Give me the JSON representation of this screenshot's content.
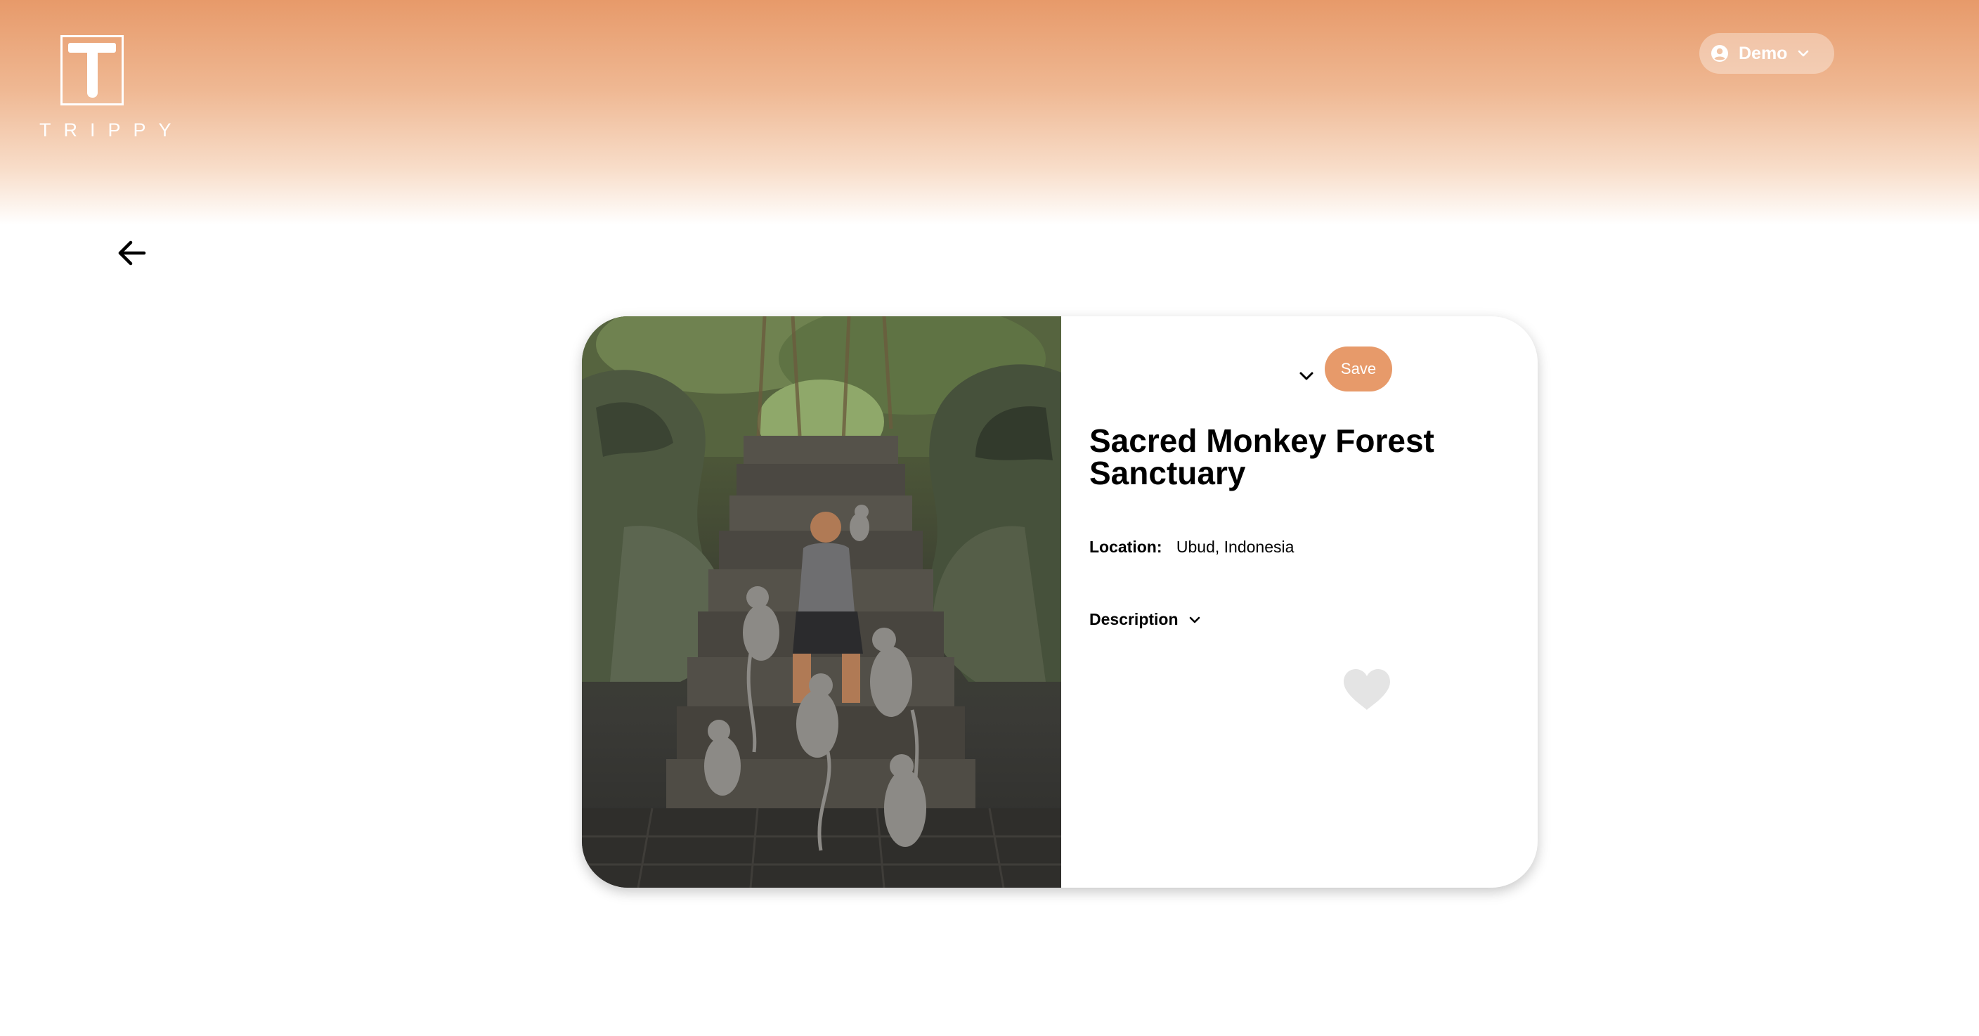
{
  "header": {
    "logo_letter": "T",
    "logo_text": "TRIPPY",
    "user_menu": {
      "label": "Demo",
      "icon": "user-circle-icon",
      "chevron": "chevron-down-icon"
    }
  },
  "nav": {
    "back_icon": "arrow-left-icon"
  },
  "place": {
    "image": "Temple staircase with stone dragon statues, a man sitting with monkeys",
    "title": "Sacred Monkey Forest Sanctuary",
    "location_label": "Location:",
    "location_value": "Ubud, Indonesia",
    "description_label": "Description",
    "save_label": "Save",
    "favorite_icon": "heart-icon"
  },
  "colors": {
    "accent": "#e79a6a",
    "text": "#000000",
    "heart": "#e4e4e4"
  }
}
